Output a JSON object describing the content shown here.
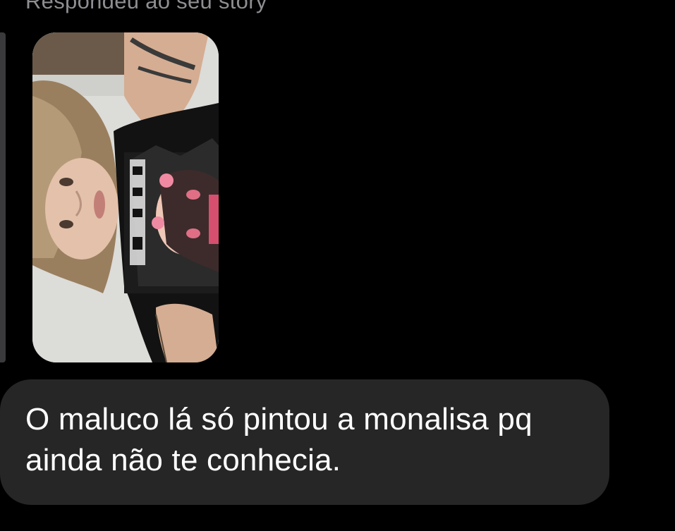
{
  "reply": {
    "label": "Respondeu ao seu story",
    "thumbnail_icon": "story-photo"
  },
  "message": {
    "text": "O maluco lá só pintou a monalisa pq ainda não te conhecia."
  },
  "colors": {
    "background": "#000000",
    "bubble": "#262626",
    "label": "#8e8e93",
    "text": "#ffffff"
  }
}
